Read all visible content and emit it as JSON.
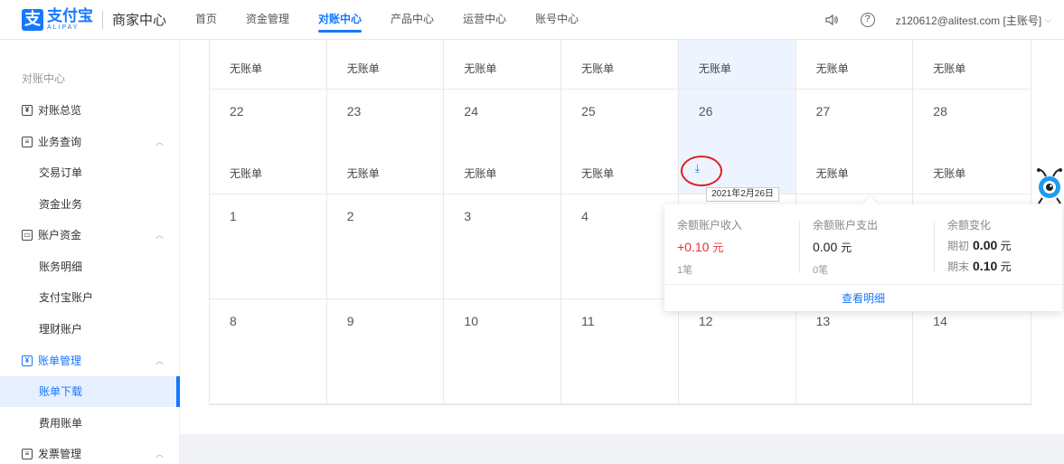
{
  "header": {
    "logo_cn": "支付宝",
    "logo_en": "ALIPAY",
    "logo_sub": "商家中心",
    "nav": [
      "首页",
      "资金管理",
      "对账中心",
      "产品中心",
      "运营中心",
      "账号中心"
    ],
    "active_nav": "对账中心",
    "account": "z120612@alitest.com [主账号]"
  },
  "sidebar": {
    "title": "对账中心",
    "items": [
      {
        "label": "对账总览",
        "icon": "reconcile-icon"
      },
      {
        "label": "业务查询",
        "icon": "query-icon"
      },
      {
        "label": "交易订单"
      },
      {
        "label": "资金业务"
      },
      {
        "label": "账户资金",
        "icon": "wallet-icon"
      },
      {
        "label": "账务明细"
      },
      {
        "label": "支付宝账户"
      },
      {
        "label": "理财账户"
      },
      {
        "label": "账单管理",
        "icon": "bill-icon"
      },
      {
        "label": "账单下载"
      },
      {
        "label": "费用账单"
      },
      {
        "label": "发票管理",
        "icon": "invoice-icon"
      }
    ]
  },
  "calendar": {
    "top_status": [
      "无账单",
      "无账单",
      "无账单",
      "无账单",
      "无账单",
      "无账单",
      "无账单"
    ],
    "week2": {
      "days": [
        "22",
        "23",
        "24",
        "25",
        "26",
        "27",
        "28"
      ],
      "status": [
        "无账单",
        "无账单",
        "无账单",
        "无账单",
        "",
        "无账单",
        "无账单"
      ]
    },
    "week3": [
      "1",
      "2",
      "3",
      "4",
      "",
      "",
      ""
    ],
    "week4": [
      "8",
      "9",
      "10",
      "11",
      "12",
      "13",
      "14"
    ],
    "download_icon": "⤓",
    "tooltip_date": "2021年2月26日"
  },
  "popover": {
    "income_label": "余额账户收入",
    "income_value": "+0.10",
    "income_unit": "元",
    "income_count": "1笔",
    "expense_label": "余额账户支出",
    "expense_value": "0.00",
    "expense_unit": "元",
    "expense_count": "0笔",
    "change_label": "余额变化",
    "start_label": "期初",
    "start_value": "0.00",
    "end_label": "期末",
    "end_value": "0.10",
    "unit": "元",
    "detail_link": "查看明细"
  }
}
